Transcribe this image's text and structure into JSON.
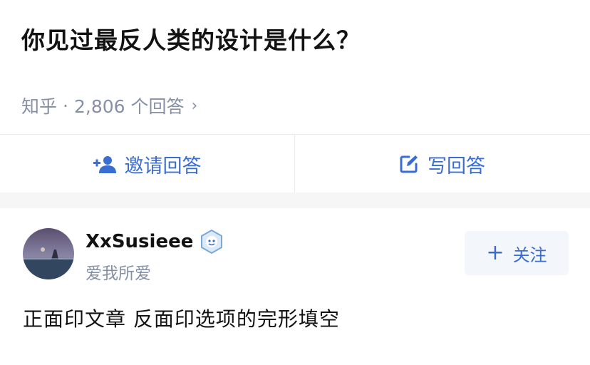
{
  "question": {
    "title": "你见过最反人类的设计是什么？",
    "source": "知乎",
    "separator": "·",
    "answer_count": "2,806 个回答",
    "chevron": "›"
  },
  "actions": {
    "invite_label": "邀请回答",
    "invite_icon": "add-user-icon",
    "write_label": "写回答",
    "write_icon": "edit-icon"
  },
  "answer": {
    "author_name": "XxSusieee",
    "author_bio": "爱我所爱",
    "badge_icon": "verified-badge-icon",
    "follow_plus": "+",
    "follow_label": "关注",
    "content": "正面印文章 反面印选项的完形填空"
  },
  "colors": {
    "accent": "#3a6dd2",
    "meta_gray": "#8590a6",
    "divider": "#ebebeb",
    "gap_bg": "#f6f6f6"
  }
}
